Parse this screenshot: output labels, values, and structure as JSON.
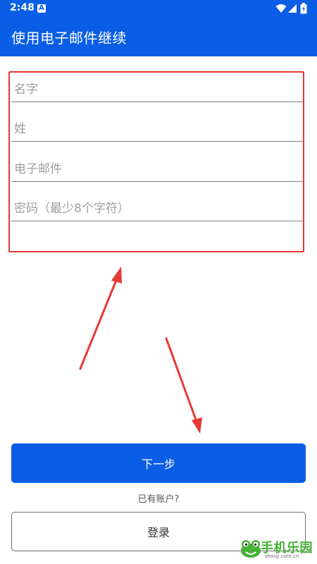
{
  "status_bar": {
    "time": "2:48",
    "notification_icon": "A",
    "icons": [
      "wifi-icon",
      "signal-icon",
      "battery-icon"
    ]
  },
  "app_bar": {
    "title": "使用电子邮件继续"
  },
  "form": {
    "first_name": {
      "placeholder": "名字",
      "value": ""
    },
    "last_name": {
      "placeholder": "姓",
      "value": ""
    },
    "email": {
      "placeholder": "电子邮件",
      "value": ""
    },
    "password": {
      "placeholder": "密码（最少8个字符）",
      "value": ""
    }
  },
  "actions": {
    "next_label": "下一步",
    "have_account_text": "已有账户?",
    "login_label": "登录"
  },
  "watermark": {
    "text": "手机乐园",
    "url": "shouji.com.cn"
  },
  "colors": {
    "primary": "#0a5ee6",
    "annotation_red": "#e53935",
    "watermark_green": "#46b236"
  }
}
